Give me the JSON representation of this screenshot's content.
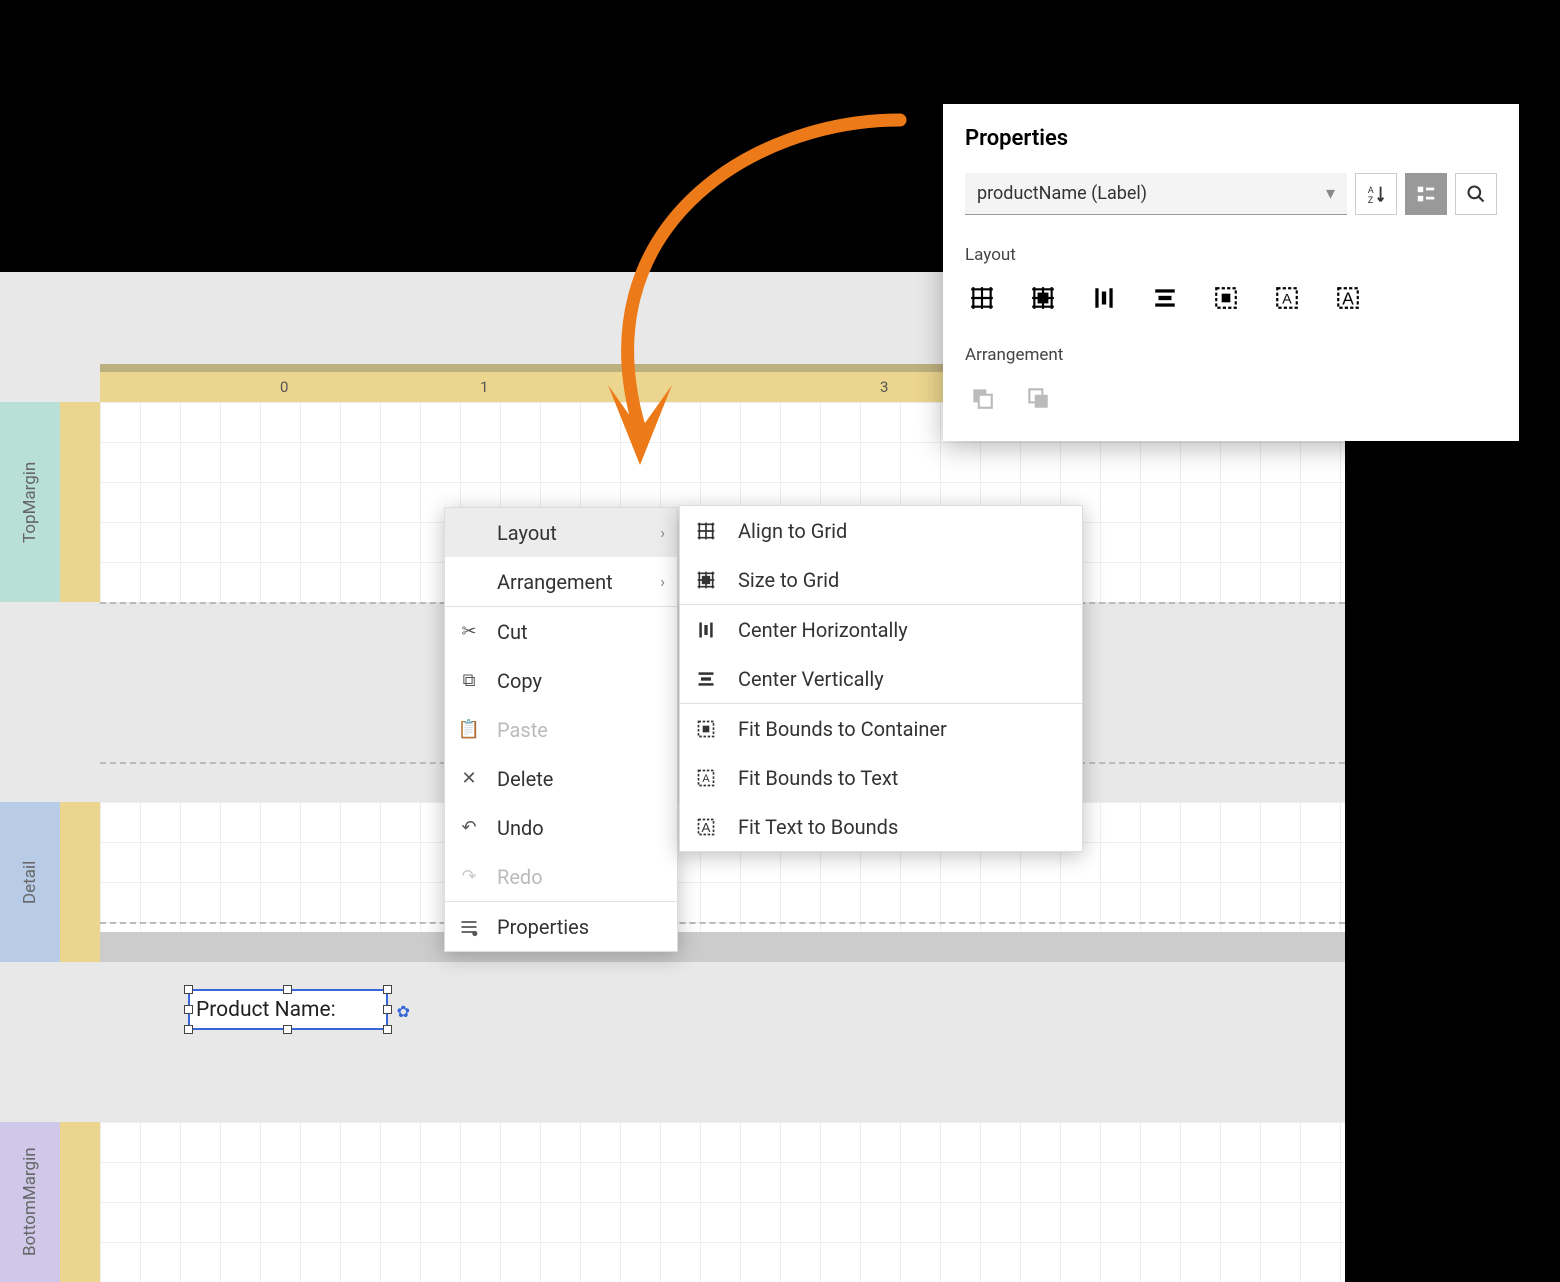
{
  "ruler": {
    "t0": "0",
    "t1": "1",
    "t3": "3"
  },
  "bands": {
    "top": "TopMargin",
    "detail": "Detail",
    "bottom": "BottomMargin"
  },
  "element": {
    "label": "Product Name:"
  },
  "contextMenu": {
    "layout": "Layout",
    "arrangement": "Arrangement",
    "cut": "Cut",
    "copy": "Copy",
    "paste": "Paste",
    "delete": "Delete",
    "undo": "Undo",
    "redo": "Redo",
    "properties": "Properties"
  },
  "submenu": {
    "alignToGrid": "Align to Grid",
    "sizeToGrid": "Size to Grid",
    "centerH": "Center Horizontally",
    "centerV": "Center Vertically",
    "fitBoundsContainer": "Fit Bounds to Container",
    "fitBoundsText": "Fit Bounds to Text",
    "fitTextBounds": "Fit Text to Bounds"
  },
  "properties": {
    "title": "Properties",
    "selector": "productName (Label)",
    "layout": "Layout",
    "arrangement": "Arrangement"
  }
}
